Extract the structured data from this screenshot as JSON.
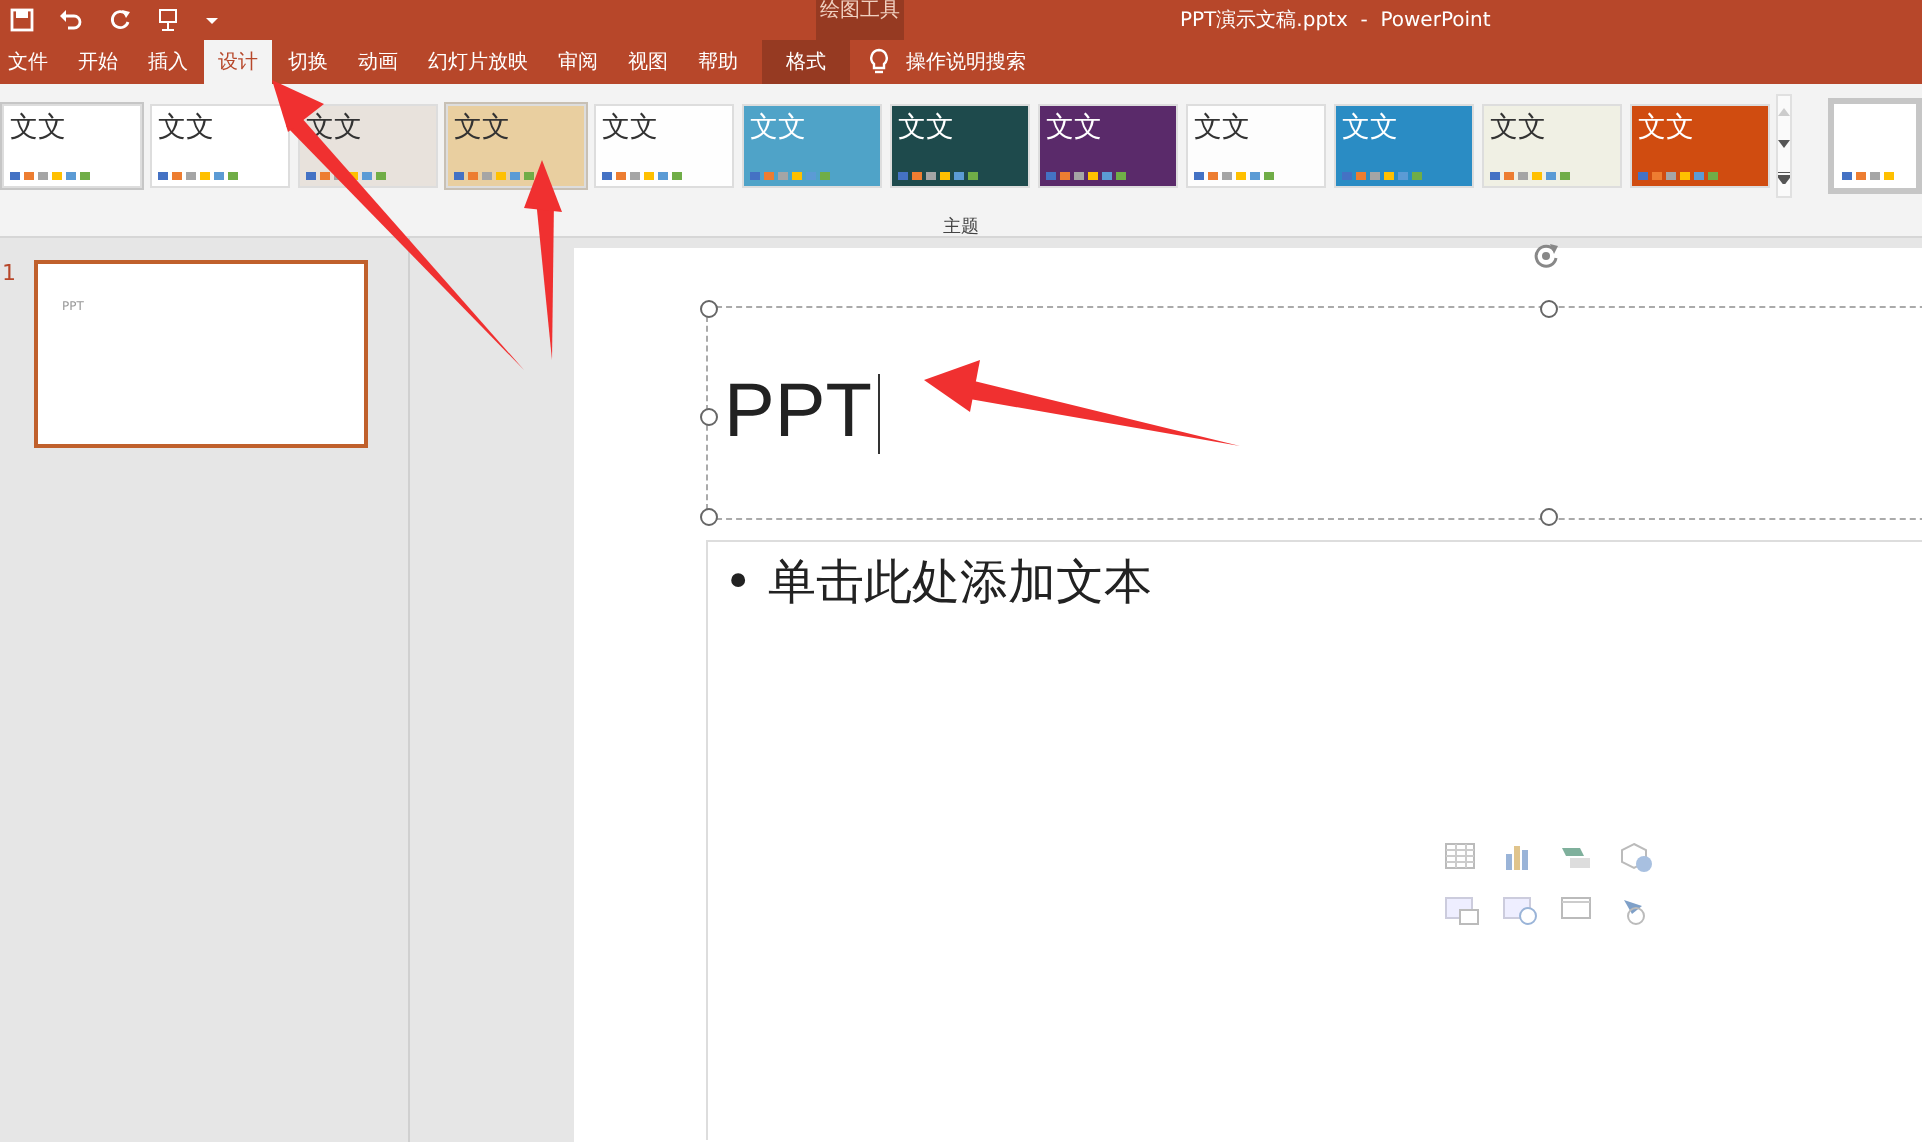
{
  "window": {
    "title": "PPT演示文稿.pptx  -  PowerPoint",
    "context_group": "绘图工具"
  },
  "tabs": [
    {
      "label": "文件",
      "selected": false,
      "contextual": false
    },
    {
      "label": "开始",
      "selected": false,
      "contextual": false
    },
    {
      "label": "插入",
      "selected": false,
      "contextual": false
    },
    {
      "label": "设计",
      "selected": true,
      "contextual": false
    },
    {
      "label": "切换",
      "selected": false,
      "contextual": false
    },
    {
      "label": "动画",
      "selected": false,
      "contextual": false
    },
    {
      "label": "幻灯片放映",
      "selected": false,
      "contextual": false
    },
    {
      "label": "审阅",
      "selected": false,
      "contextual": false
    },
    {
      "label": "视图",
      "selected": false,
      "contextual": false
    },
    {
      "label": "帮助",
      "selected": false,
      "contextual": false
    },
    {
      "label": "格式",
      "selected": false,
      "contextual": true
    }
  ],
  "tell_me": {
    "placeholder": "操作说明搜索"
  },
  "themes": {
    "group_label": "主题",
    "items": [
      {
        "label": "文文",
        "color": "#ffffff",
        "selected": true,
        "hovered": false
      },
      {
        "label": "文文",
        "color": "#ffffff",
        "selected": false,
        "hovered": false
      },
      {
        "label": "文文",
        "color": "#e8e2dc",
        "selected": false,
        "hovered": false
      },
      {
        "label": "文文",
        "color": "#e9cfa0",
        "selected": false,
        "hovered": true
      },
      {
        "label": "文文",
        "color": "#fefefe",
        "selected": false,
        "hovered": false
      },
      {
        "label": "文文",
        "color": "#4fa3c8",
        "selected": false,
        "hovered": false
      },
      {
        "label": "文文",
        "color": "#1e4a4c",
        "selected": false,
        "hovered": false
      },
      {
        "label": "文文",
        "color": "#5a2a6a",
        "selected": false,
        "hovered": false
      },
      {
        "label": "文文",
        "color": "#fdfdfd",
        "selected": false,
        "hovered": false
      },
      {
        "label": "文文",
        "color": "#2a8cc4",
        "selected": false,
        "hovered": false
      },
      {
        "label": "文文",
        "color": "#f0f0e4",
        "selected": false,
        "hovered": false
      },
      {
        "label": "文文",
        "color": "#d04c10",
        "selected": false,
        "hovered": false
      }
    ]
  },
  "slides": [
    {
      "number": "1",
      "title": "PPT",
      "selected": true
    }
  ],
  "slide": {
    "title": "PPT",
    "body_placeholder": "• 单击此处添加文本"
  }
}
